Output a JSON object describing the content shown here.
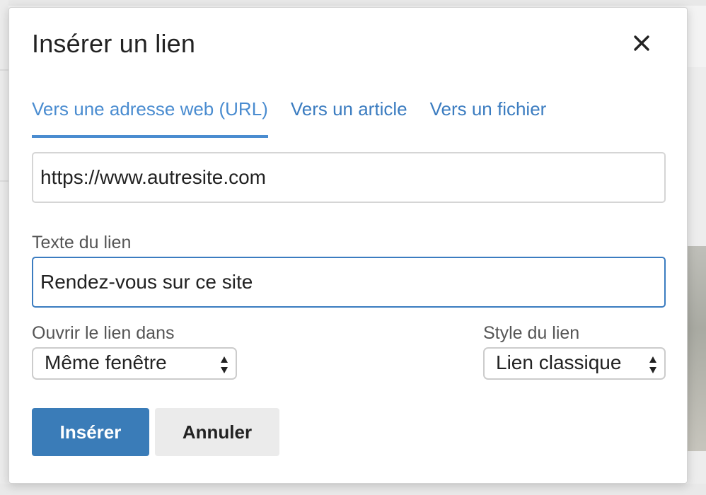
{
  "dialog": {
    "title": "Insérer un lien",
    "close_icon": "close-icon"
  },
  "tabs": [
    {
      "label": "Vers une adresse web (URL)",
      "active": true
    },
    {
      "label": "Vers un article",
      "active": false
    },
    {
      "label": "Vers un fichier",
      "active": false
    }
  ],
  "url_field": {
    "value": "https://www.autresite.com"
  },
  "link_text": {
    "label": "Texte du lien",
    "value": "Rendez-vous sur ce site"
  },
  "open_in": {
    "label": "Ouvrir le lien dans",
    "selected": "Même fenêtre"
  },
  "link_style": {
    "label": "Style du lien",
    "selected": "Lien classique"
  },
  "actions": {
    "insert_label": "Insérer",
    "cancel_label": "Annuler"
  },
  "colors": {
    "accent": "#4a8cd0",
    "primary_button": "#3a7cb8",
    "secondary_button": "#ebebeb"
  }
}
